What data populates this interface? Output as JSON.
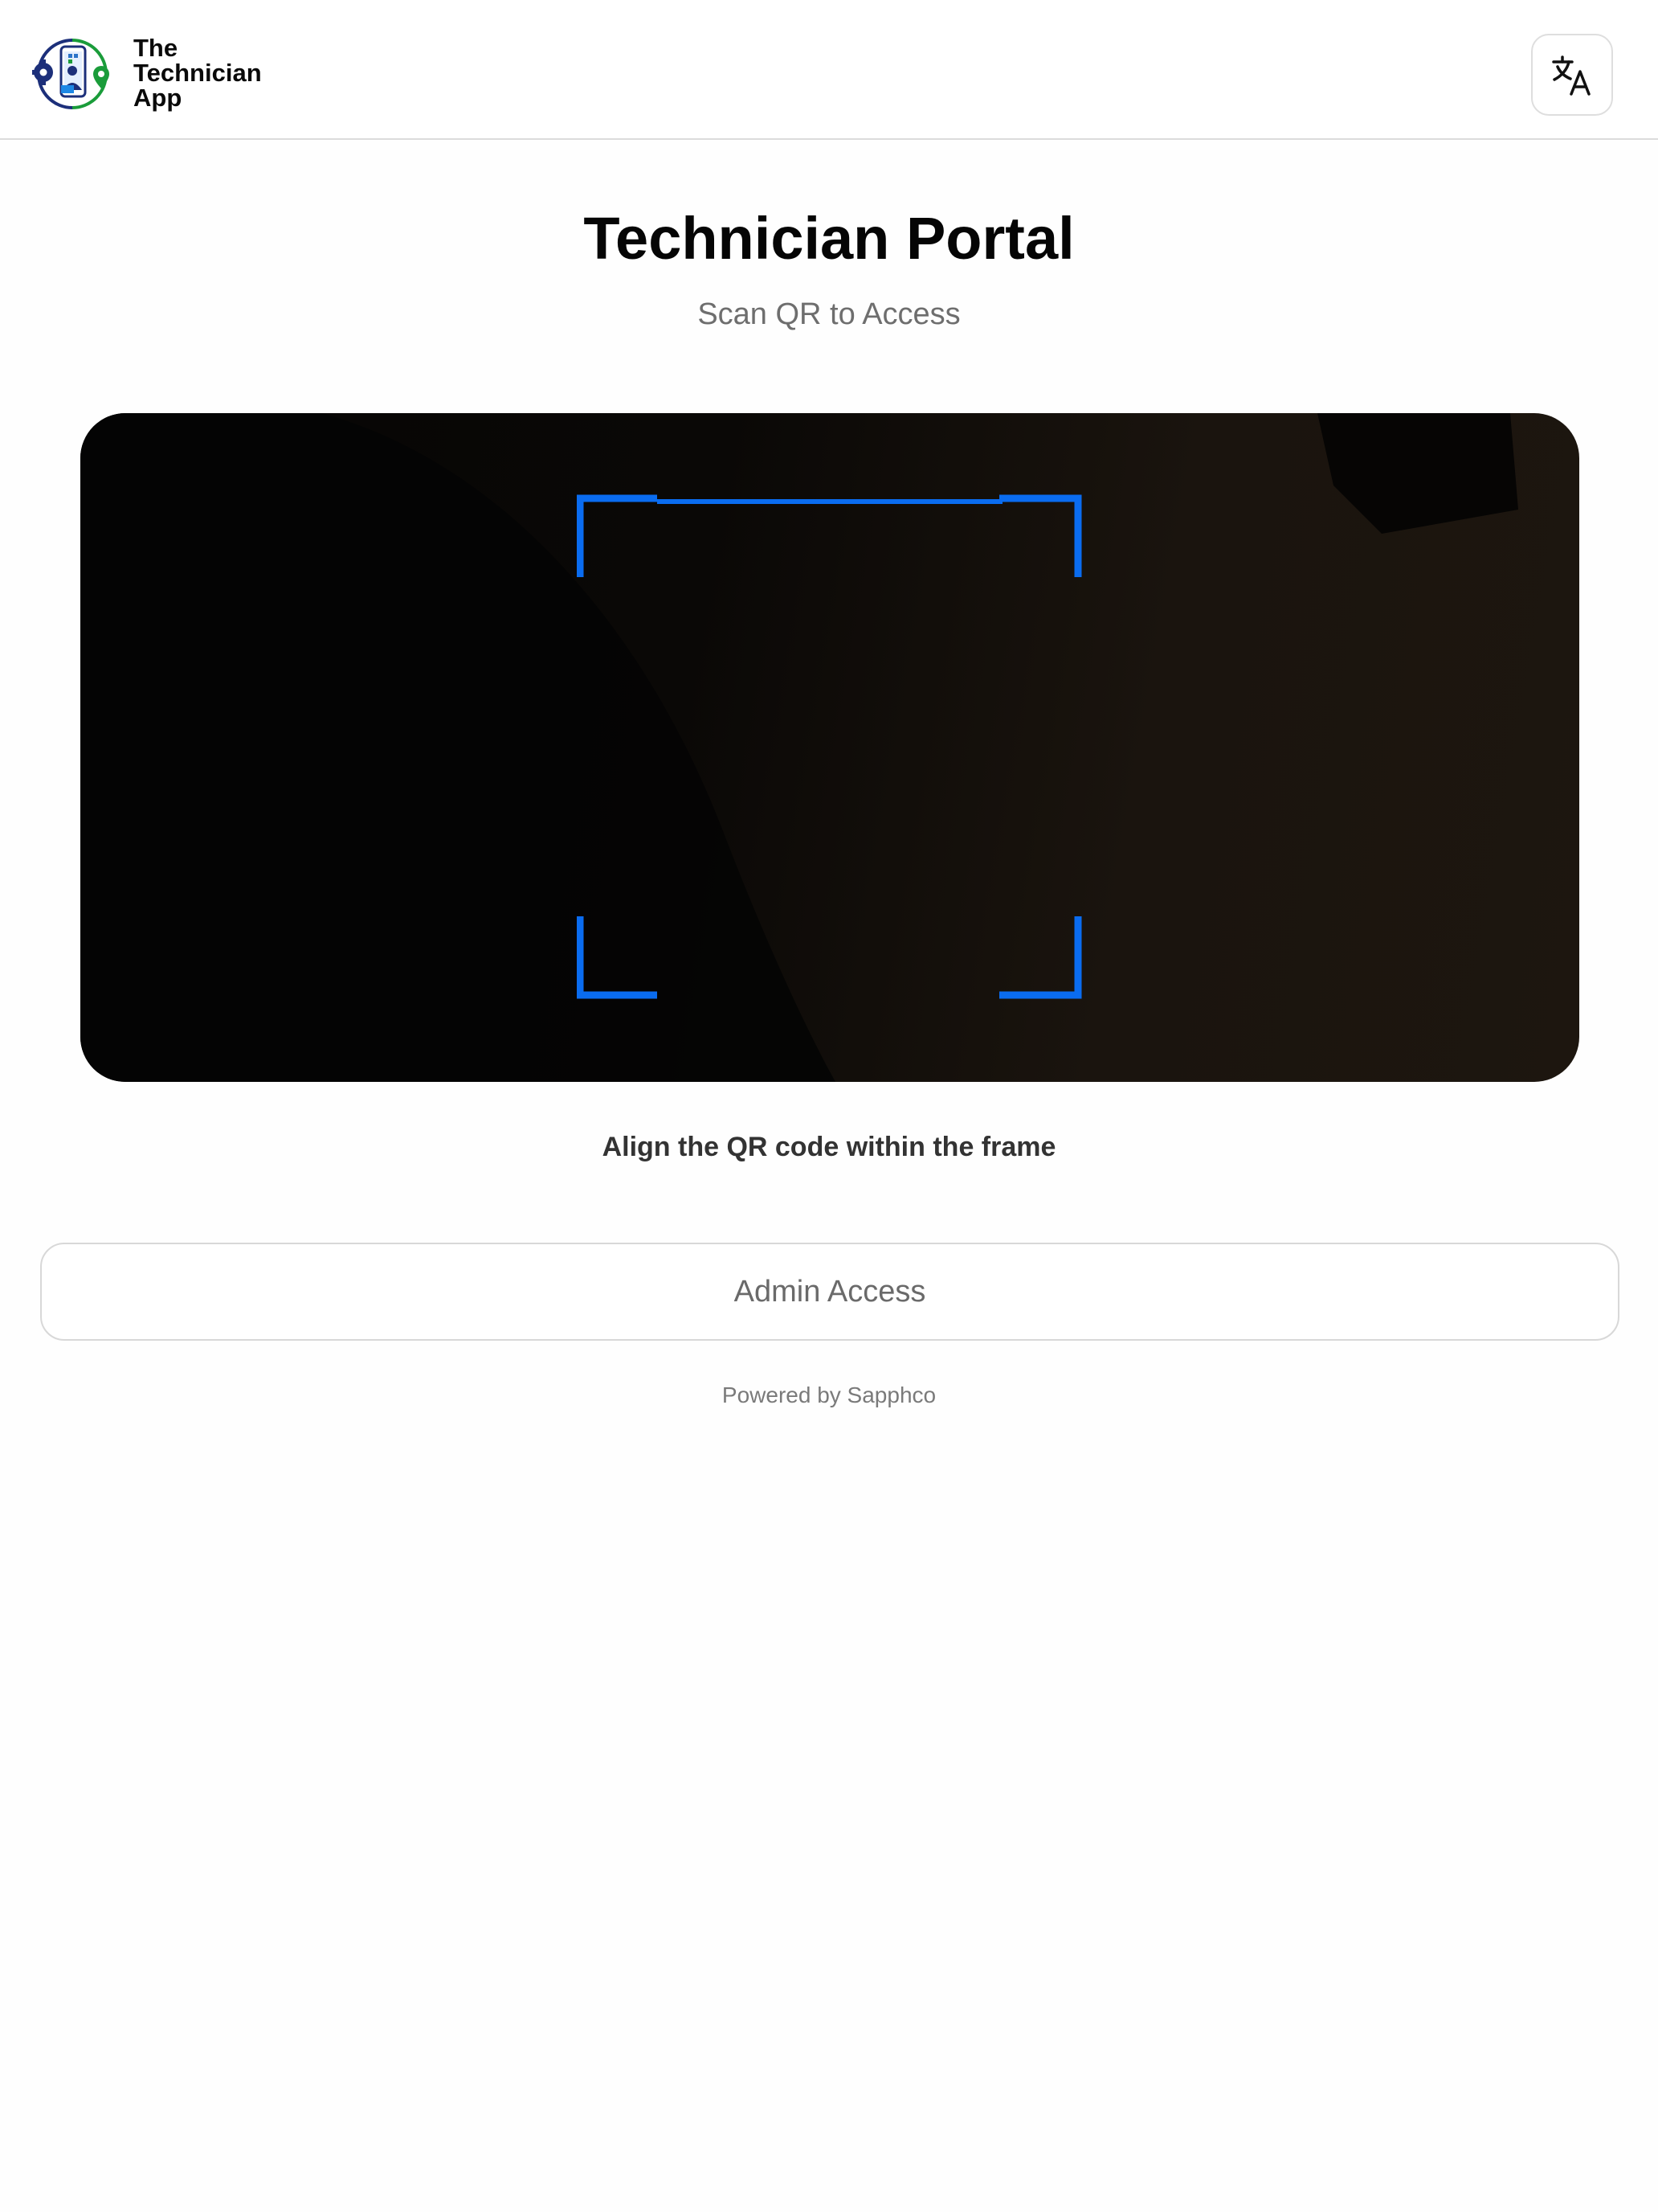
{
  "header": {
    "logo_icon": "technician-app-logo",
    "brand_line1": "The",
    "brand_line2": "Technician",
    "brand_line3": "App",
    "language_button_icon": "translate-icon"
  },
  "main": {
    "title": "Technician Portal",
    "subtitle": "Scan QR to Access",
    "scanner": {
      "frame_color": "#0a6cf0",
      "hint": "Align the QR code within the frame"
    },
    "admin_button_label": "Admin Access"
  },
  "footer": {
    "text": "Powered by Sapphco"
  },
  "colors": {
    "accent": "#0a6cf0",
    "logo_navy": "#1c2f7a",
    "logo_green": "#1a9c3a"
  }
}
